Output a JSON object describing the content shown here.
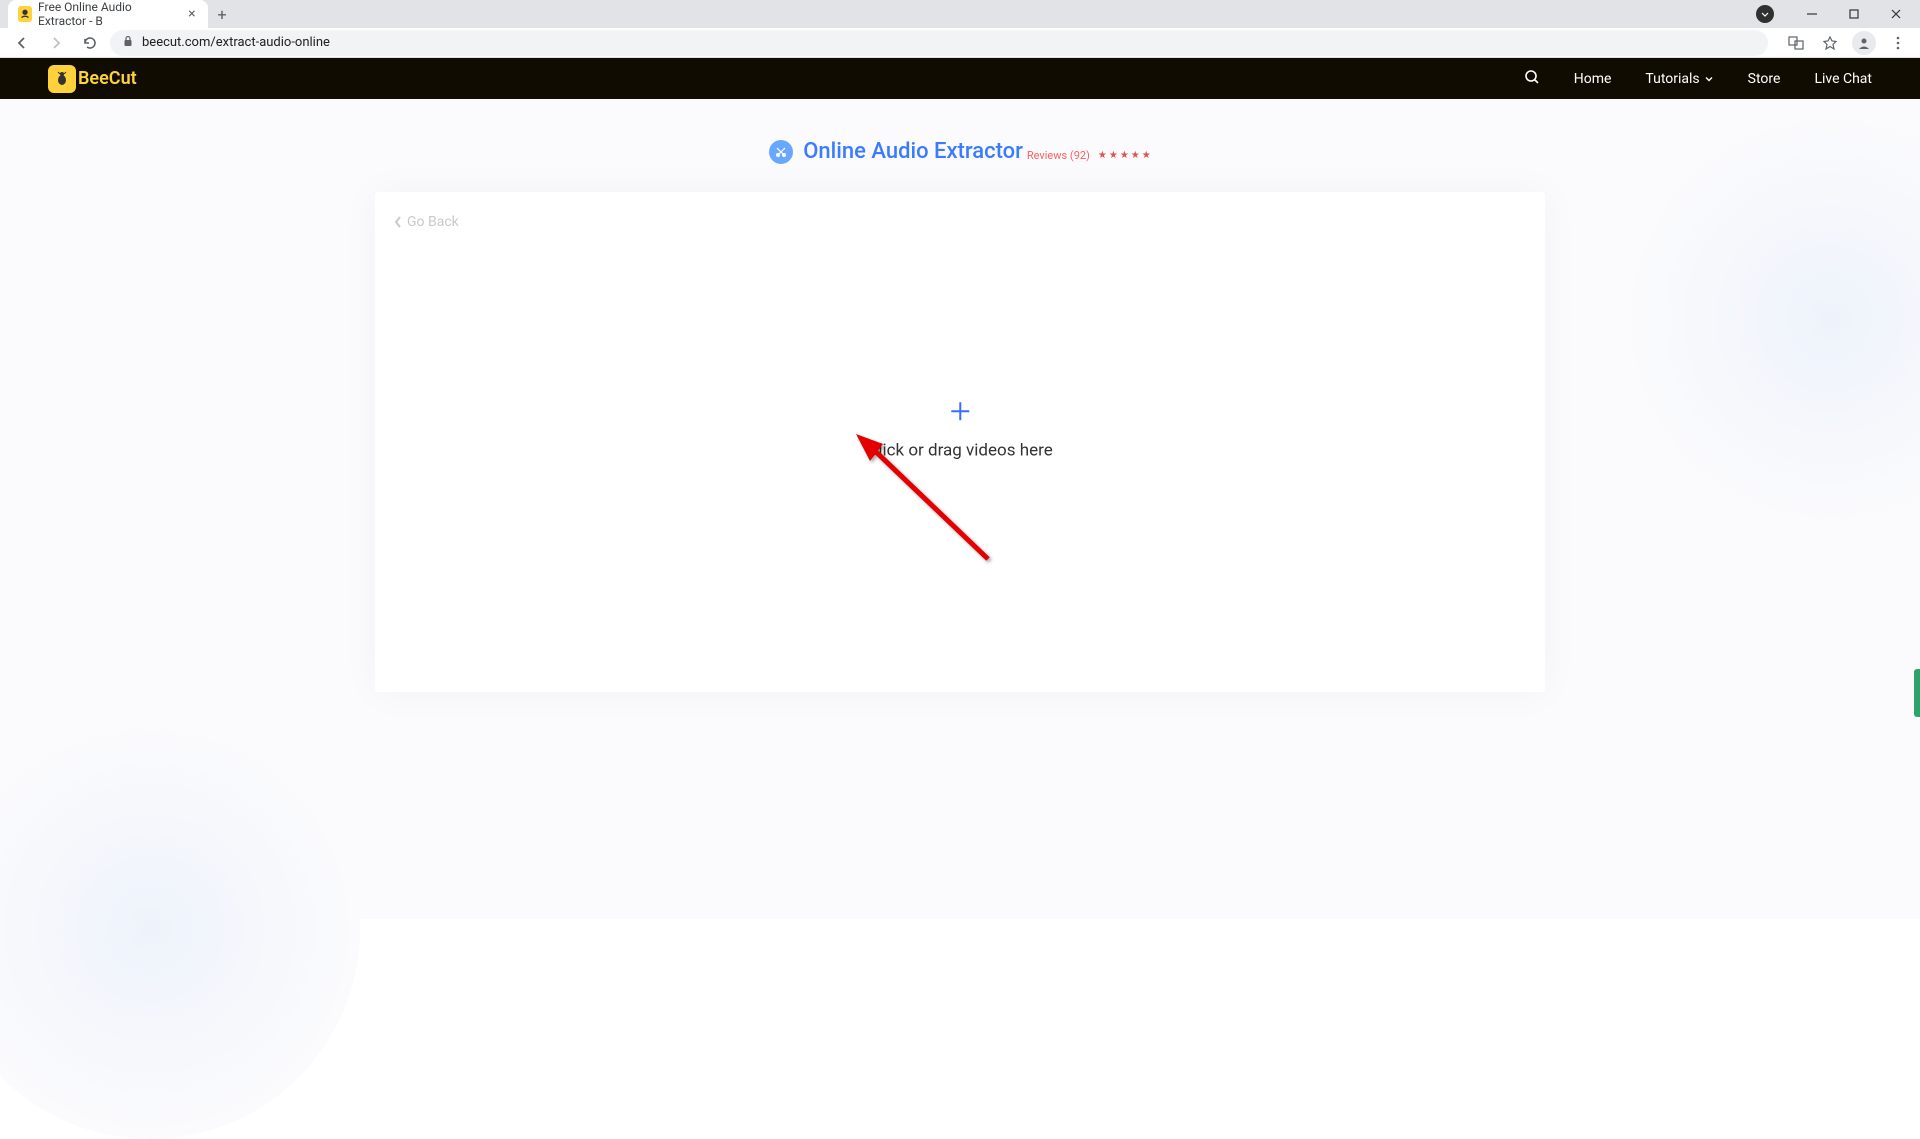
{
  "browser": {
    "tab_title": "Free Online Audio Extractor - B",
    "url": "beecut.com/extract-audio-online"
  },
  "header": {
    "brand": "BeeCut",
    "nav": {
      "home": "Home",
      "tutorials": "Tutorials",
      "store": "Store",
      "live_chat": "Live Chat"
    }
  },
  "page": {
    "title": "Online Audio Extractor",
    "reviews_label": "Reviews (92)",
    "go_back": "Go Back",
    "drop_text": "Click or drag videos here"
  }
}
